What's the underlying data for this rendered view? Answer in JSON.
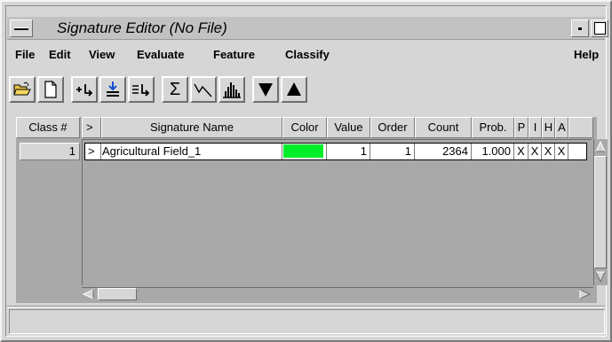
{
  "window": {
    "title": "Signature Editor (No File)"
  },
  "menubar": {
    "items": [
      "File",
      "Edit",
      "View",
      "Evaluate",
      "Feature",
      "Classify"
    ],
    "help": "Help"
  },
  "toolbar": {
    "buttons": [
      "open-folder-icon",
      "new-file-icon",
      "add-signature-icon",
      "replace-signature-icon",
      "merge-signature-icon",
      "statistics-sigma-icon",
      "mean-plot-icon",
      "histogram-icon",
      "move-down-arrow-icon",
      "move-up-arrow-icon"
    ],
    "sigma_glyph": "Σ"
  },
  "table": {
    "columns": [
      "Class #",
      ">",
      "Signature Name",
      "Color",
      "Value",
      "Order",
      "Count",
      "Prob.",
      "P",
      "I",
      "H",
      "A"
    ],
    "rows": [
      {
        "class_num": "1",
        "marker": ">",
        "name": "Agricultural Field_1",
        "color": "#00ee2a",
        "value": "1",
        "order": "1",
        "count": "2364",
        "prob": "1.000",
        "p": "X",
        "i": "X",
        "h": "X",
        "a": "X"
      }
    ]
  },
  "status": {
    "text": ""
  }
}
